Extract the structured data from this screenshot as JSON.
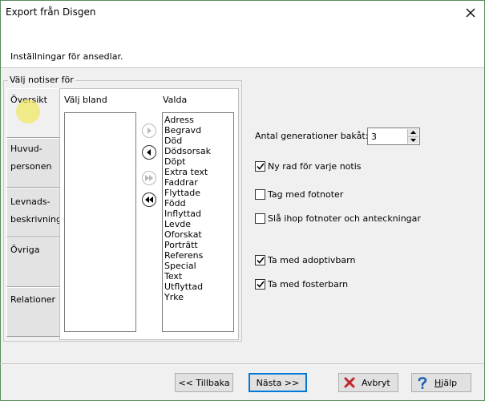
{
  "window": {
    "title": "Export från Disgen"
  },
  "header": {
    "subtitle": "Inställningar för ansedlar."
  },
  "group": {
    "label": "Välj notiser för"
  },
  "tabs": [
    {
      "line1": "Översikt",
      "line2": ""
    },
    {
      "line1": "Huvud-",
      "line2": "personen"
    },
    {
      "line1": "Levnads-",
      "line2": "beskrivning"
    },
    {
      "line1": "Övriga",
      "line2": ""
    },
    {
      "line1": "Relationer",
      "line2": ""
    }
  ],
  "panel": {
    "left_label": "Välj bland",
    "right_label": "Valda",
    "available": [],
    "selected": [
      "Adress",
      "Begravd",
      "Död",
      "Dödsorsak",
      "Döpt",
      "Extra text",
      "Faddrar",
      "Flyttade",
      "Född",
      "Inflyttad",
      "Levde",
      "Oforskat",
      "Porträtt",
      "Referens",
      "Special",
      "Text",
      "Utflyttad",
      "Yrke"
    ]
  },
  "options": {
    "generations_label": "Antal generationer bakåt:",
    "generations_value": "3",
    "checks": [
      {
        "label": "Ny rad för varje notis",
        "checked": true
      },
      {
        "label": "Tag med fotnoter",
        "checked": false
      },
      {
        "label": "Slå ihop fotnoter och anteckningar",
        "checked": false
      },
      {
        "label": "Ta med adoptivbarn",
        "checked": true
      },
      {
        "label": "Ta med fosterbarn",
        "checked": true
      }
    ]
  },
  "buttons": {
    "back": "<< Tillbaka",
    "next": "Nästa >>",
    "cancel": "Avbryt",
    "help": "Hjälp"
  },
  "colors": {
    "accent": "#0078d7",
    "cancel_icon": "#c0282d",
    "help_icon": "#1a5fb4",
    "highlight": "#f0e650"
  }
}
